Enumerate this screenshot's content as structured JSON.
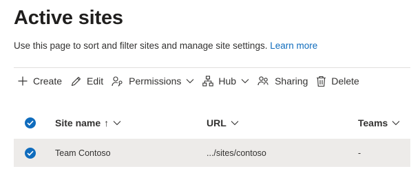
{
  "page": {
    "title": "Active sites",
    "description": "Use this page to sort and filter sites and manage site settings.",
    "learn_more": "Learn more"
  },
  "toolbar": {
    "create": "Create",
    "edit": "Edit",
    "permissions": "Permissions",
    "hub": "Hub",
    "sharing": "Sharing",
    "delete": "Delete"
  },
  "table": {
    "columns": {
      "site_name": "Site name",
      "site_name_sort": "↑",
      "url": "URL",
      "teams": "Teams"
    },
    "rows": [
      {
        "site_name": "Team Contoso",
        "url": ".../sites/contoso",
        "teams": "-",
        "selected": true
      }
    ]
  },
  "colors": {
    "accent": "#0f6cbd",
    "selected_row": "#edebe9"
  }
}
